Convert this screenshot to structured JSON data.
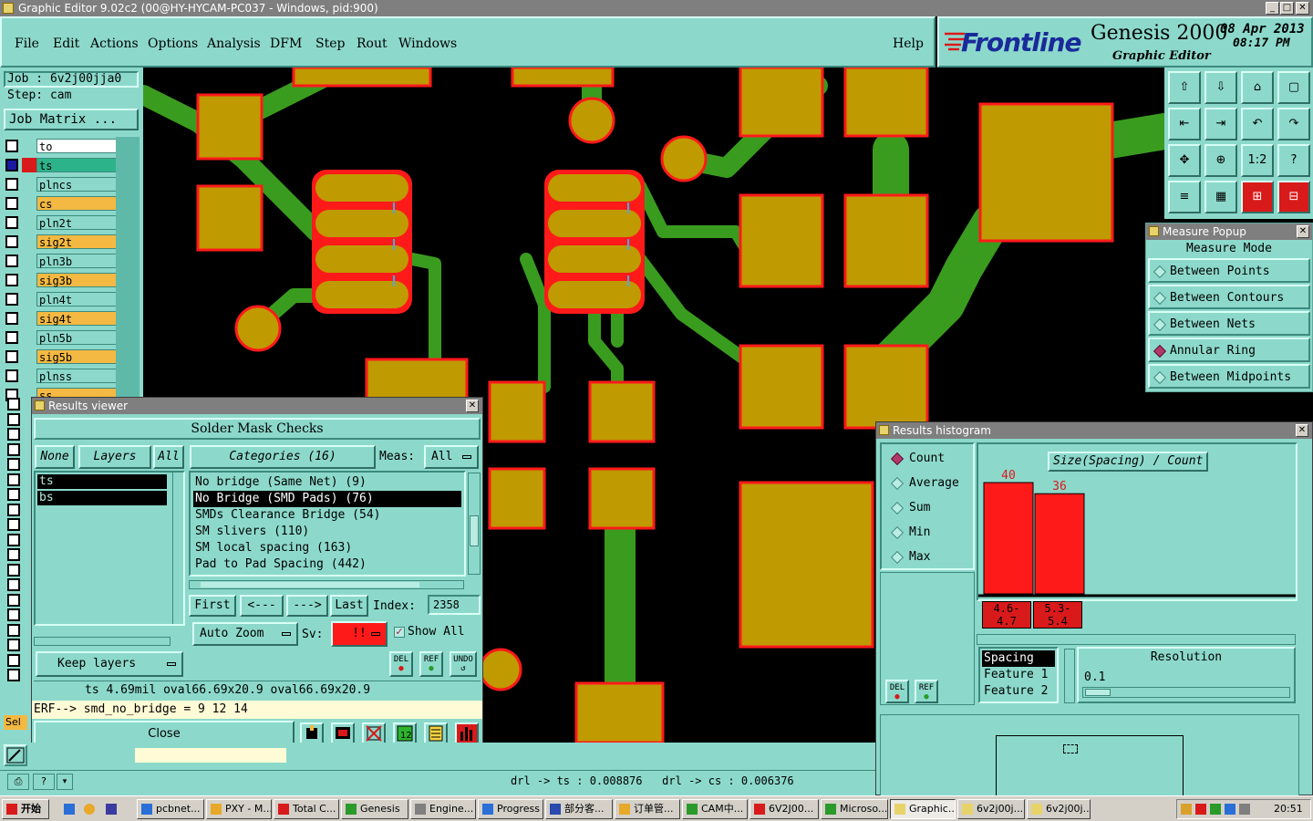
{
  "window": {
    "title": "Graphic Editor 9.02c2 (00@HY-HYCAM-PC037 - Windows, pid:900)"
  },
  "menu": [
    "File",
    "Edit",
    "Actions",
    "Options",
    "Analysis",
    "DFM",
    "Step",
    "Rout",
    "Windows"
  ],
  "help_label": "Help",
  "brand": {
    "logo": "Frontline",
    "product": "Genesis 2000",
    "subtitle": "Graphic Editor",
    "date": "08 Apr 2013",
    "time": "08:17 PM"
  },
  "job": {
    "job_label": "Job : 6v2j00jja0",
    "step_label": "Step: cam",
    "matrix_button": "Job Matrix ..."
  },
  "layers": [
    {
      "name": "to",
      "color": "#ffffff",
      "active": true
    },
    {
      "name": "ts",
      "color": "#2db38a",
      "active": true
    },
    {
      "name": "plncs",
      "color": "#8cd9cb",
      "active": false
    },
    {
      "name": "cs",
      "color": "#f4b942",
      "active": true
    },
    {
      "name": "pln2t",
      "color": "#8cd9cb",
      "active": false
    },
    {
      "name": "sig2t",
      "color": "#f4b942",
      "active": true
    },
    {
      "name": "pln3b",
      "color": "#8cd9cb",
      "active": false
    },
    {
      "name": "sig3b",
      "color": "#f4b942",
      "active": true
    },
    {
      "name": "pln4t",
      "color": "#8cd9cb",
      "active": false
    },
    {
      "name": "sig4t",
      "color": "#f4b942",
      "active": true
    },
    {
      "name": "pln5b",
      "color": "#8cd9cb",
      "active": false
    },
    {
      "name": "sig5b",
      "color": "#f4b942",
      "active": true
    },
    {
      "name": "plnss",
      "color": "#8cd9cb",
      "active": false
    },
    {
      "name": "ss",
      "color": "#f4b942",
      "active": true
    }
  ],
  "tools": [
    "home-up",
    "home-down",
    "house",
    "panel",
    "left",
    "right",
    "undo-box",
    "redo-box",
    "fit",
    "center",
    "1:2",
    "help",
    "ruler",
    "grid",
    "net-a",
    "net-b"
  ],
  "measure": {
    "title": "Measure Popup",
    "header": "Measure Mode",
    "options": [
      {
        "label": "Between Points",
        "selected": false
      },
      {
        "label": "Between Contours",
        "selected": false
      },
      {
        "label": "Between Nets",
        "selected": false
      },
      {
        "label": "Annular Ring",
        "selected": true
      },
      {
        "label": "Between Midpoints",
        "selected": false
      }
    ]
  },
  "results": {
    "title": "Results viewer",
    "heading": "Solder Mask Checks",
    "none": "None",
    "layers": "Layers",
    "all": "All",
    "categories_btn": "Categories (16)",
    "meas_label": "Meas:",
    "meas_value": "All",
    "layer_list": [
      "ts",
      "bs"
    ],
    "categories": [
      {
        "label": "No bridge (Same Net) (9)",
        "selected": false
      },
      {
        "label": "No Bridge (SMD Pads) (76)",
        "selected": true
      },
      {
        "label": "SMDs Clearance Bridge (54)",
        "selected": false
      },
      {
        "label": "SM slivers (110)",
        "selected": false
      },
      {
        "label": "SM local spacing (163)",
        "selected": false
      },
      {
        "label": "Pad to Pad Spacing (442)",
        "selected": false
      }
    ],
    "first": "First",
    "prev": "<---",
    "next": "--->",
    "last": "Last",
    "index_label": "Index:",
    "index_value": "2358",
    "auto_zoom": "Auto Zoom",
    "sv_label": "Sv:",
    "sv_value": "!!",
    "show_all": "Show All",
    "keep_layers": "Keep layers",
    "del": "DEL",
    "ref": "REF",
    "undo": "UNDO",
    "info": "ts 4.69mil   oval66.69x20.9   oval66.69x20.9",
    "erf": "ERF--> smd_no_bridge = 9 12 14",
    "close": "Close"
  },
  "histogram": {
    "title": "Results histogram",
    "modes": [
      {
        "label": "Count",
        "selected": true
      },
      {
        "label": "Average",
        "selected": false
      },
      {
        "label": "Sum",
        "selected": false
      },
      {
        "label": "Min",
        "selected": false
      },
      {
        "label": "Max",
        "selected": false
      }
    ],
    "chart_title": "Size(Spacing) / Count",
    "bars": [
      {
        "count": 40,
        "range": "4.6-\n4.7"
      },
      {
        "count": 36,
        "range": "5.3-\n5.4"
      }
    ],
    "y_max": 40,
    "list": [
      "Spacing",
      "Feature 1",
      "Feature 2"
    ],
    "resolution_label": "Resolution",
    "resolution_value": "0.1",
    "del": "DEL",
    "ref": "REF"
  },
  "status": {
    "drill_text": "drl -> ts : 0.008876   drl -> cs : 0.006376",
    "sel_label": "Sel"
  },
  "taskbar": {
    "start": "开始",
    "clock": "20:51",
    "tasks": [
      "pcbnet...",
      "PXY - M...",
      "Total C...",
      "Genesis",
      "Engine...",
      "Progress",
      "部分客...",
      "订单管...",
      "CAM中...",
      "6V2J00...",
      "Microso...",
      "Graphic...",
      "6v2j00j...",
      "6v2j00j..."
    ]
  },
  "colors": {
    "panel": "#8cd9cb",
    "copper": "#bf9a00",
    "mask": "#ff1a1a",
    "trace": "#3a9c1f",
    "bar": "#ff1a1a"
  }
}
